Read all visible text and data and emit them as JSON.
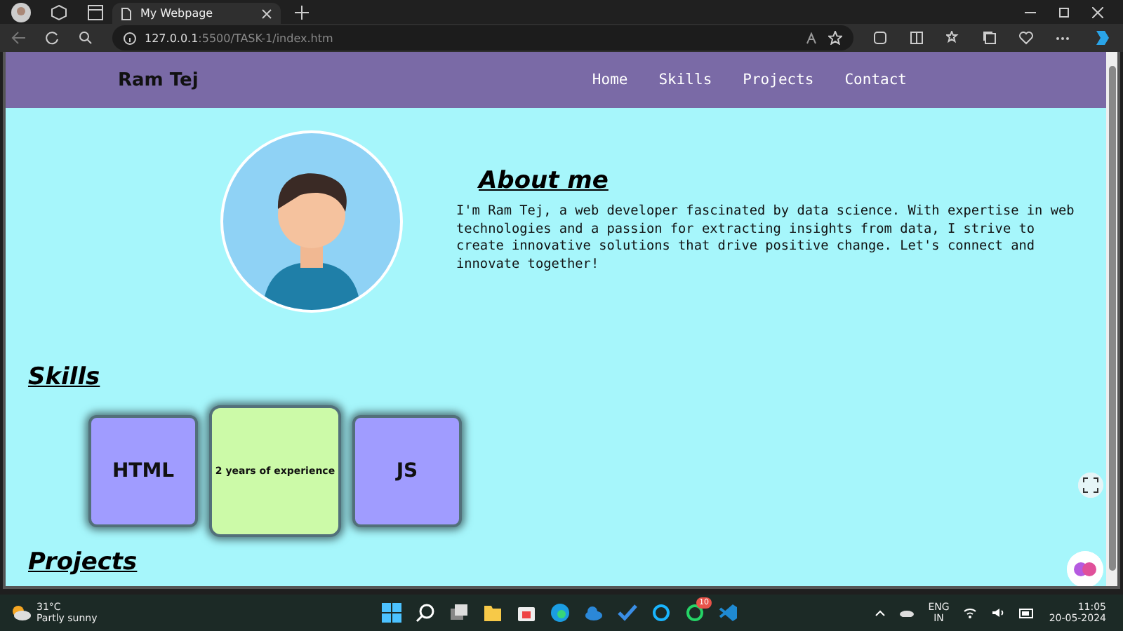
{
  "browser": {
    "tab_title": "My Webpage",
    "url_host": "127.0.0.1",
    "url_path": ":5500/TASK-1/index.htm"
  },
  "site": {
    "brand": "Ram Tej",
    "nav": [
      "Home",
      "Skills",
      "Projects",
      "Contact"
    ]
  },
  "about": {
    "title": "About me",
    "text": "I'm Ram Tej, a web developer fascinated by data science. With expertise in web technologies and a passion for extracting insights from data, I strive to create innovative solutions that drive positive change. Let's connect and innovate together!"
  },
  "skills": {
    "title": "Skills",
    "cards": [
      {
        "label": "HTML",
        "highlighted": false
      },
      {
        "label": "2 years of experience",
        "highlighted": true
      },
      {
        "label": "JS",
        "highlighted": false
      }
    ]
  },
  "projects": {
    "title": "Projects"
  },
  "taskbar": {
    "weather_temp": "31°C",
    "weather_text": "Partly sunny",
    "chat_badge": "10",
    "language": "ENG",
    "region": "IN",
    "time": "11:05",
    "date": "20-05-2024"
  }
}
